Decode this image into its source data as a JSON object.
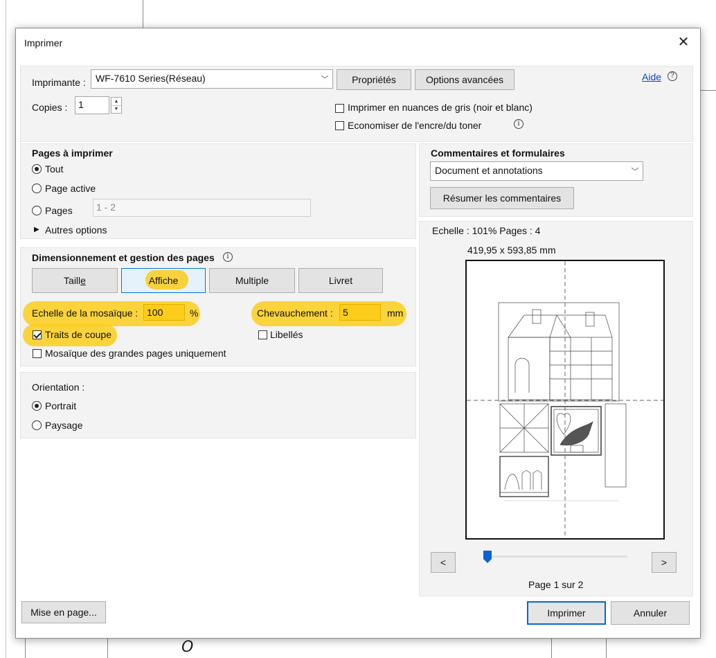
{
  "dialog": {
    "title": "Imprimer",
    "close_icon": "close-icon"
  },
  "printer": {
    "label": "Imprimante :",
    "selected": "WF-7610 Series(Réseau)",
    "properties_button": "Propriétés",
    "advanced_button": "Options avancées",
    "help_link": "Aide",
    "help_icon": "?",
    "copies_label": "Copies :",
    "copies_value": "1",
    "grayscale_label": "Imprimer en nuances de gris (noir et blanc)",
    "grayscale_checked": false,
    "save_ink_label": "Economiser de l'encre/du toner",
    "save_ink_checked": false
  },
  "pages": {
    "title": "Pages à imprimer",
    "options": [
      {
        "label": "Tout",
        "selected": true
      },
      {
        "label": "Page active",
        "selected": false
      },
      {
        "label": "Pages",
        "selected": false
      }
    ],
    "range_placeholder": "1 - 2",
    "more_options": "Autres options"
  },
  "sizing": {
    "title": "Dimensionnement et gestion des pages",
    "tabs": [
      {
        "label_pre": "Taill",
        "label_underline": "e",
        "active": false
      },
      {
        "label": "Affiche",
        "active": true
      },
      {
        "label": "Multiple",
        "active": false
      },
      {
        "label": "Livret",
        "active": false
      }
    ],
    "tile_scale_label": "Echelle de la mosaïque :",
    "tile_scale_value": "100",
    "tile_scale_unit": "%",
    "overlap_label": "Chevauchement :",
    "overlap_value": "5",
    "overlap_unit": "mm",
    "cut_marks_label": "Traits de coupe",
    "cut_marks_checked": true,
    "labels_label": "Libellés",
    "labels_checked": false,
    "large_only_label": "Mosaïque des grandes pages uniquement",
    "large_only_checked": false
  },
  "orientation": {
    "title": "Orientation :",
    "options": [
      {
        "label": "Portrait",
        "selected": true
      },
      {
        "label": "Paysage",
        "selected": false
      }
    ]
  },
  "comments": {
    "title": "Commentaires et formulaires",
    "selected": "Document et annotations",
    "summarize_button": "Résumer les commentaires"
  },
  "preview": {
    "scale_text": "Echelle : 101% Pages : 4",
    "size_text": "419,95 x 593,85 mm",
    "prev_button": "<",
    "next_button": ">",
    "page_text": "Page 1 sur 2",
    "page_current": 1,
    "page_total": 2
  },
  "footer": {
    "page_setup_button": "Mise en page...",
    "print_button": "Imprimer",
    "cancel_button": "Annuler"
  },
  "colors": {
    "highlight": "#fccc1a",
    "accent": "#0078d7",
    "link": "#0645c8"
  }
}
